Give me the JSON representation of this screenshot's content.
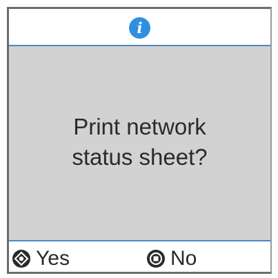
{
  "dialog": {
    "icon": "info-icon",
    "icon_glyph": "i",
    "message_line1": "Print network",
    "message_line2": "status sheet?"
  },
  "softkeys": {
    "yes": {
      "icon": "ok-button-icon",
      "label": "Yes"
    },
    "no": {
      "icon": "stop-button-icon",
      "label": "No"
    }
  },
  "colors": {
    "accent_blue": "#2f8fe0",
    "divider_blue": "#4e86c9",
    "message_background": "#d2d2d2",
    "text": "#2a2a2a"
  }
}
